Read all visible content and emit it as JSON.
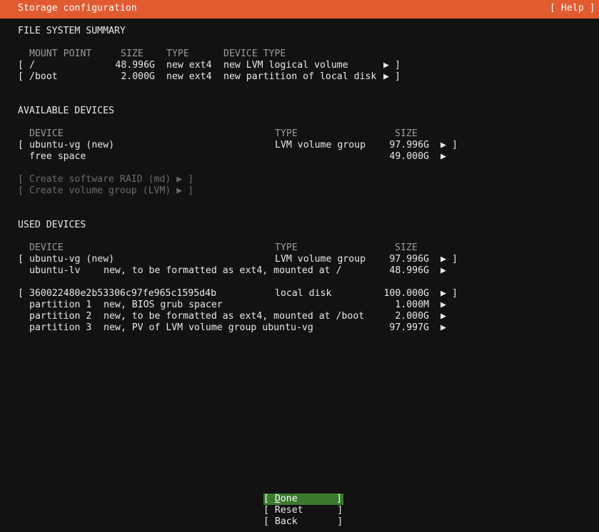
{
  "header": {
    "title": "Storage configuration",
    "help": "[ Help ]"
  },
  "fs_summary": {
    "heading": "FILE SYSTEM SUMMARY",
    "columns": [
      "MOUNT POINT",
      "SIZE",
      "TYPE",
      "DEVICE TYPE"
    ],
    "rows": [
      {
        "open": "[",
        "mount": "/",
        "size": "48.996G",
        "type": "new ext4",
        "device_type": "new LVM logical volume",
        "arrow": "▶",
        "close": "]"
      },
      {
        "open": "[",
        "mount": "/boot",
        "size": "2.000G",
        "type": "new ext4",
        "device_type": "new partition of local disk",
        "arrow": "▶",
        "close": "]"
      }
    ]
  },
  "available": {
    "heading": "AVAILABLE DEVICES",
    "columns": [
      "DEVICE",
      "TYPE",
      "SIZE"
    ],
    "rows": [
      {
        "open": "[",
        "device": "ubuntu-vg (new)",
        "type": "LVM volume group",
        "size": "97.996G",
        "arrow": "▶",
        "close": "]"
      },
      {
        "device": "free space",
        "type": "",
        "size": "49.000G",
        "arrow": "▶"
      }
    ],
    "actions": [
      "[ Create software RAID (md) ▶ ]",
      "[ Create volume group (LVM) ▶ ]"
    ]
  },
  "used": {
    "heading": "USED DEVICES",
    "columns": [
      "DEVICE",
      "TYPE",
      "SIZE"
    ],
    "vg_row": {
      "open": "[",
      "device": "ubuntu-vg (new)",
      "type": "LVM volume group",
      "size": "97.996G",
      "arrow": "▶",
      "close": "]"
    },
    "lv_row": {
      "device": "ubuntu-lv",
      "desc": "new, to be formatted as ext4, mounted at /",
      "size": "48.996G",
      "arrow": "▶"
    },
    "disk_row": {
      "open": "[",
      "device": "360022480e2b53306c97fe965c1595d4b",
      "type": "local disk",
      "size": "100.000G",
      "arrow": "▶",
      "close": "]"
    },
    "partitions": [
      {
        "device": "partition 1",
        "desc": "new, BIOS grub spacer",
        "size": "1.000M",
        "arrow": "▶"
      },
      {
        "device": "partition 2",
        "desc": "new, to be formatted as ext4, mounted at /boot",
        "size": "2.000G",
        "arrow": "▶"
      },
      {
        "device": "partition 3",
        "desc": "new, PV of LVM volume group ubuntu-vg",
        "size": "97.997G",
        "arrow": "▶"
      }
    ]
  },
  "buttons": {
    "done": {
      "open": "[ ",
      "hot": "D",
      "rest": "one",
      "close": "]"
    },
    "reset": "[ Reset      ]",
    "back": "[ Back       ]"
  },
  "colors": {
    "header": "#e25a2f",
    "background": "#121212",
    "selected": "#3a7a2e"
  }
}
